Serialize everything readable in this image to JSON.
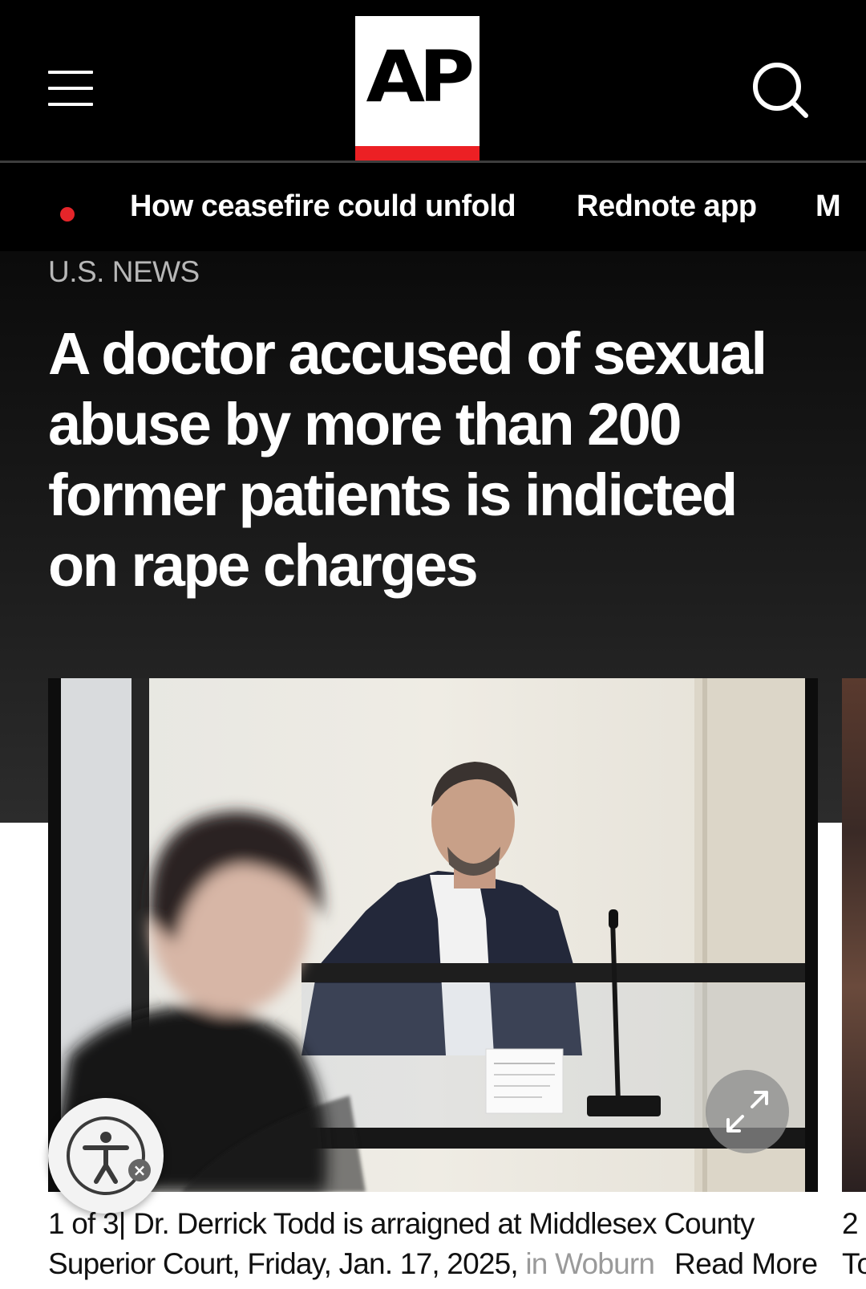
{
  "header": {
    "menu_icon": "hamburger-menu-icon",
    "logo_text": "AP",
    "search_icon": "search-icon",
    "colors": {
      "background": "#000000",
      "logo_bar": "#ec2024"
    }
  },
  "trending": {
    "live_indicator_color": "#e5252a",
    "items": [
      {
        "label": "How ceasefire could unfold"
      },
      {
        "label": "Rednote app"
      },
      {
        "label": "M"
      }
    ]
  },
  "article": {
    "section": "U.S. NEWS",
    "headline": "A doctor accused of sexual abuse by more than 200 former patients is indicted on rape charges"
  },
  "gallery": {
    "counter": "1 of 3",
    "separator": "|",
    "caption_line1": "Dr. Derrick Todd is arraigned at Middlesex County",
    "caption_line2": "Superior Court, Friday, Jan. 17, 2025,",
    "caption_faded": "in Woburn",
    "read_more": "Read More",
    "expand_icon": "expand-icon",
    "next_counter": "2",
    "next_caption": "To"
  },
  "accessibility": {
    "icon": "accessibility-person-icon",
    "close_icon": "close-icon",
    "close_symbol": "×"
  }
}
